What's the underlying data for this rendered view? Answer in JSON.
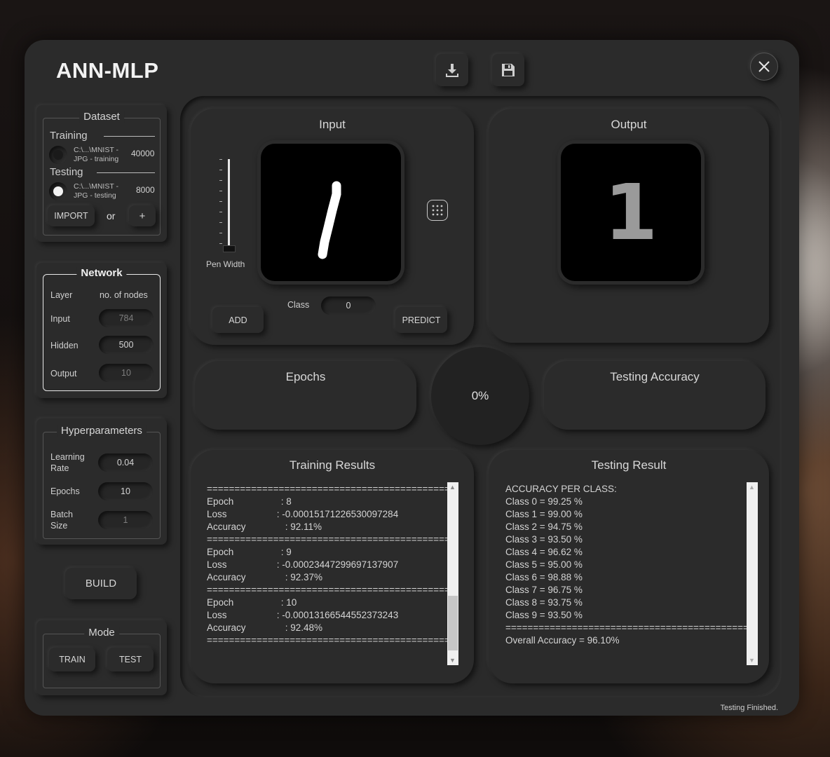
{
  "app": {
    "title": "ANN-MLP",
    "status": "Testing Finished."
  },
  "toolbar": {
    "download_icon": "download-icon",
    "save_icon": "floppy-disk-icon",
    "close_icon": "close-icon"
  },
  "dataset": {
    "legend": "Dataset",
    "training": {
      "label": "Training",
      "path": "C:\\...\\MNIST -\nJPG - training",
      "count": "40000",
      "selected": false
    },
    "testing": {
      "label": "Testing",
      "path": "C:\\...\\MNIST -\nJPG - testing",
      "count": "8000",
      "selected": true
    },
    "import_label": "IMPORT",
    "or_label": "or",
    "add_label": "+"
  },
  "network": {
    "legend": "Network",
    "col_layer": "Layer",
    "col_nodes": "no. of nodes",
    "rows": [
      {
        "label": "Input",
        "value": "784"
      },
      {
        "label": "Hidden",
        "value": "500"
      },
      {
        "label": "Output",
        "value": "10"
      }
    ]
  },
  "hyper": {
    "legend": "Hyperparameters",
    "lr_label": "Learning\nRate",
    "lr_value": "0.04",
    "epochs_label": "Epochs",
    "epochs_value": "10",
    "batch_label": "Batch\nSize",
    "batch_value": "1"
  },
  "build_label": "BUILD",
  "mode": {
    "legend": "Mode",
    "train_label": "TRAIN",
    "test_label": "TEST"
  },
  "input": {
    "title": "Input",
    "pen_width_label": "Pen Width",
    "class_label": "Class",
    "class_value": "0",
    "add_label": "ADD",
    "predict_label": "PREDICT",
    "grid_icon": "grid-dots-icon"
  },
  "output": {
    "title": "Output",
    "digit": "1"
  },
  "epochs_card": {
    "title": "Epochs"
  },
  "progress": {
    "text": "0%",
    "value": 0
  },
  "testing_accuracy": {
    "title": "Testing Accuracy"
  },
  "training_results": {
    "title": "Training Results",
    "text": "=================================================\nEpoch                  : 8\nLoss                   : -0.00015171226530097284\nAccuracy               : 92.11%\n=================================================\nEpoch                  : 9\nLoss                   : -0.00023447299697137907\nAccuracy               : 92.37%\n=================================================\nEpoch                  : 10\nLoss                   : -0.00013166544552373243\nAccuracy               : 92.48%\n================================================="
  },
  "testing_result": {
    "title": "Testing Result",
    "text": "ACCURACY PER CLASS:\nClass 0 = 99.25 %\nClass 1 = 99.00 %\nClass 2 = 94.75 %\nClass 3 = 93.50 %\nClass 4 = 96.62 %\nClass 5 = 95.00 %\nClass 6 = 98.88 %\nClass 7 = 96.75 %\nClass 8 = 93.75 %\nClass 9 = 93.50 %\n==================================================\nOverall Accuracy = 96.10%"
  }
}
